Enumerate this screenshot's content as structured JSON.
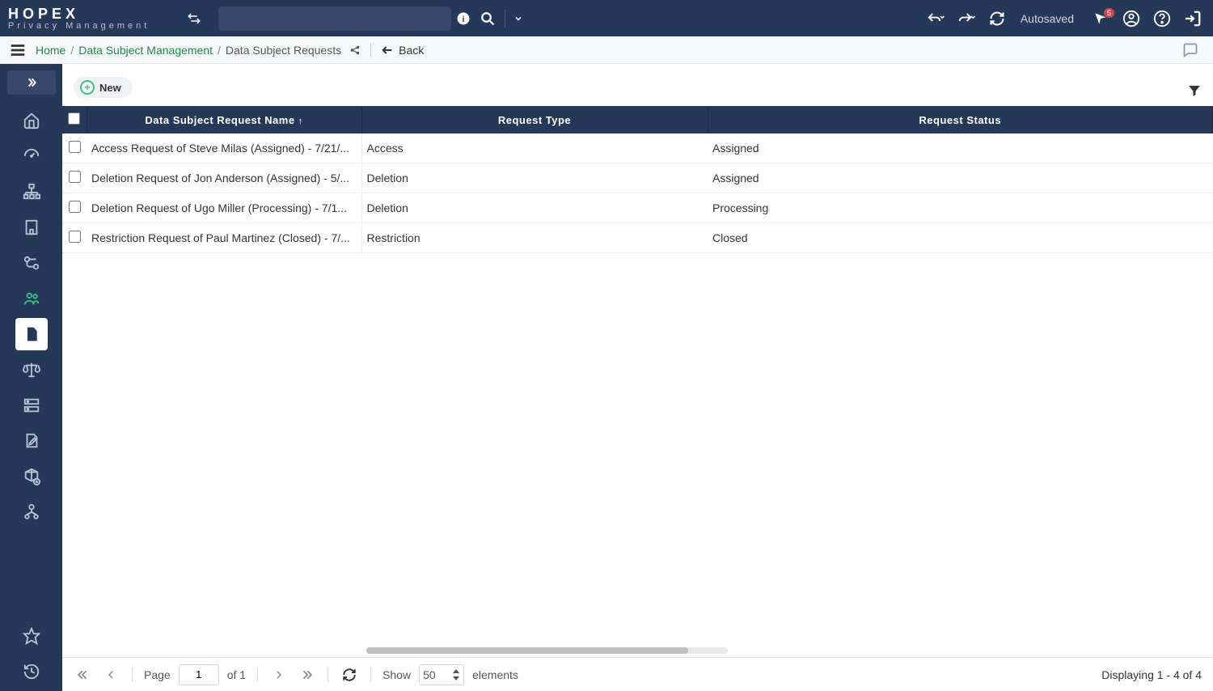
{
  "app": {
    "name": "HOPEX",
    "subtitle": "Privacy Management"
  },
  "header": {
    "autosaved": "Autosaved",
    "notif_count": "5"
  },
  "breadcrumb": {
    "home": "Home",
    "parent": "Data Subject Management",
    "current": "Data Subject Requests",
    "back": "Back"
  },
  "toolbar": {
    "new_label": "New"
  },
  "table": {
    "columns": {
      "name": "Data Subject Request Name",
      "type": "Request Type",
      "status": "Request Status"
    },
    "rows": [
      {
        "name": "Access Request of Steve Milas (Assigned) - 7/21/...",
        "type": "Access",
        "status": "Assigned"
      },
      {
        "name": "Deletion Request of Jon Anderson (Assigned) - 5/...",
        "type": "Deletion",
        "status": "Assigned"
      },
      {
        "name": "Deletion Request of Ugo Miller (Processing) - 7/1...",
        "type": "Deletion",
        "status": "Processing"
      },
      {
        "name": "Restriction Request of Paul Martinez (Closed) - 7/...",
        "type": "Restriction",
        "status": "Closed"
      }
    ]
  },
  "pager": {
    "page_label": "Page",
    "page_num": "1",
    "of_label": "of 1",
    "show_label": "Show",
    "page_size": "50",
    "elements_label": "elements",
    "display_text": "Displaying 1 - 4 of 4"
  }
}
